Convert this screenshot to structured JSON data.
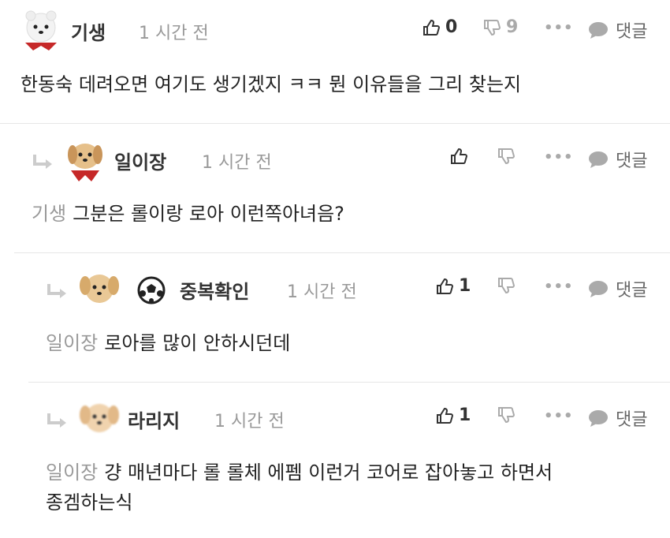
{
  "comments": [
    {
      "nick": "기생",
      "time": "1 시간 전",
      "likes": "0",
      "dislikes": "9",
      "reply_label": "댓글",
      "lines": [
        "한동숙 데려오면 여기도 생기겠지 ㅋㅋ 뭔 이유들을 그리 찾는지"
      ],
      "mention": ""
    },
    {
      "nick": "일이장",
      "time": "1 시간 전",
      "likes": "",
      "dislikes": "",
      "reply_label": "댓글",
      "mention": "기생",
      "lines": [
        "그분은 롤이랑 로아 이런쪽아녀음?"
      ]
    },
    {
      "nick": "중복확인",
      "time": "1 시간 전",
      "likes": "1",
      "dislikes": "",
      "reply_label": "댓글",
      "mention": "일이장",
      "lines": [
        "로아를 많이 안하시던데"
      ]
    },
    {
      "nick": "라리지",
      "time": "1 시간 전",
      "likes": "1",
      "dislikes": "",
      "reply_label": "댓글",
      "mention": "일이장",
      "lines": [
        "걍 매년마다 롤 롤체 에펨 이런거 코어로 잡아놓고 하면서",
        "종겜하는식"
      ]
    }
  ],
  "colors": {
    "accent": "#333333",
    "muted": "#999999",
    "divider": "#e6e6e6"
  },
  "icons": [
    "thumbs-up-icon",
    "thumbs-down-icon",
    "more-icon",
    "speech-bubble-icon",
    "reply-arrow-icon",
    "soccer-ball-icon"
  ]
}
